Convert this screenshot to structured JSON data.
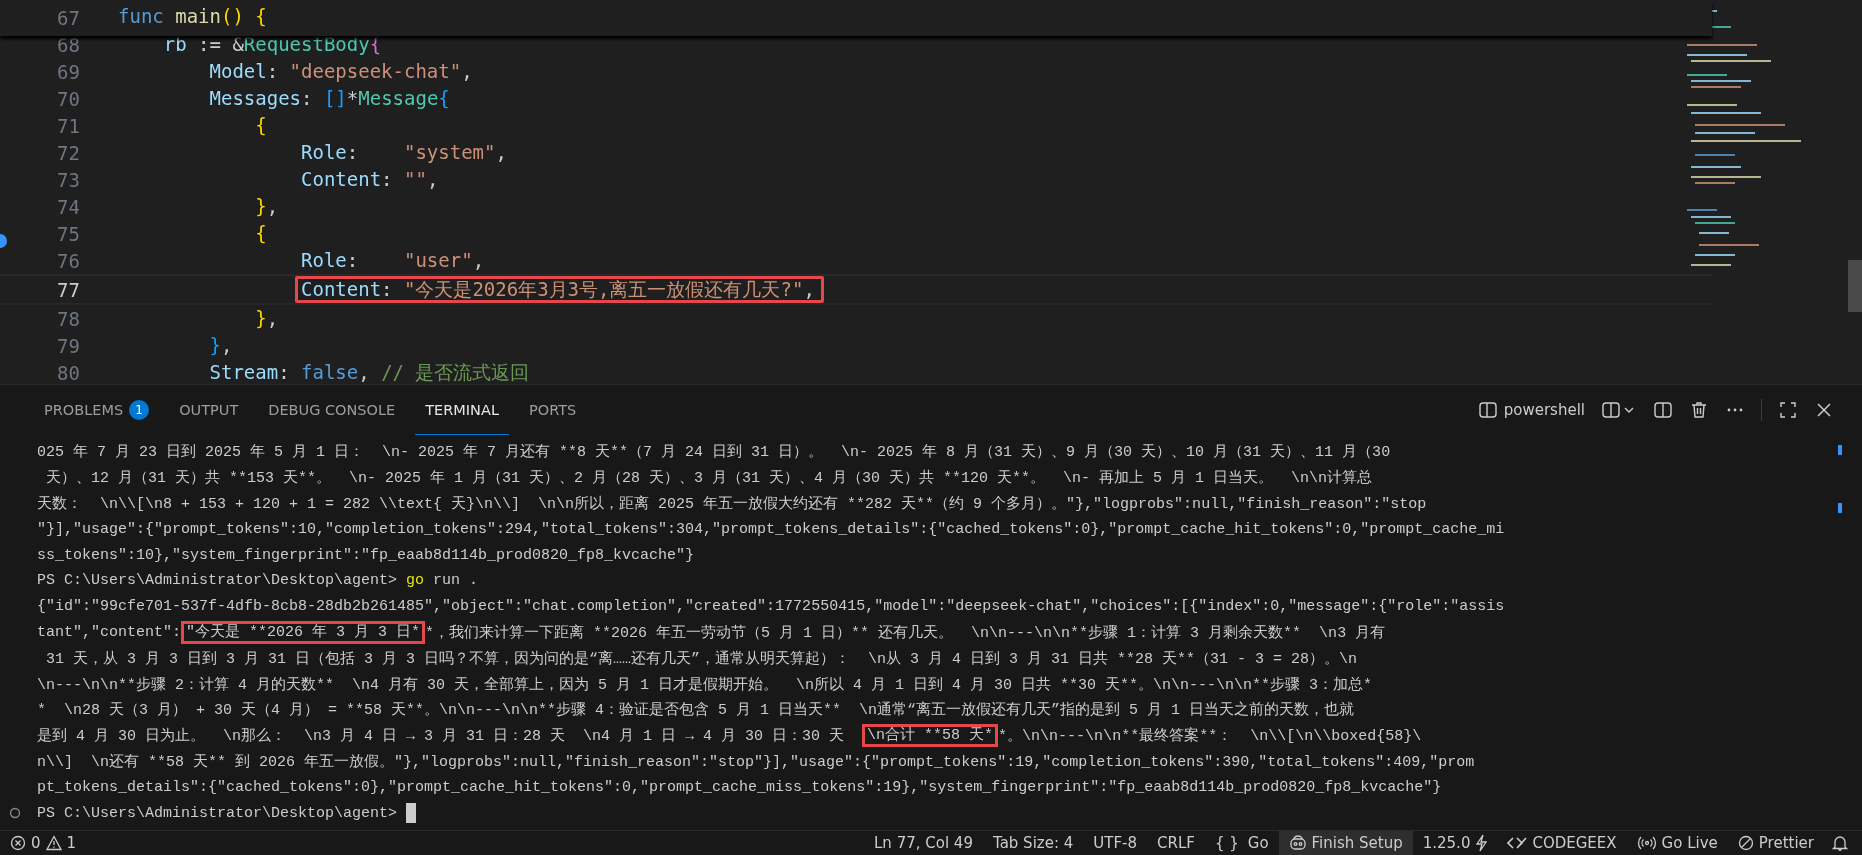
{
  "editor": {
    "code": {
      "number": "67",
      "tokens": [
        {
          "text": "func",
          "kind": "keyword"
        },
        {
          "text": " main",
          "kind": "function"
        },
        {
          "text": "()",
          "kind": "bracket1"
        },
        {
          "text": " {",
          "kind": "bracket1"
        }
      ],
      "children": [
        {
          "number": "68",
          "boxed": false,
          "current": false,
          "tokens": [
            {
              "text": "rb",
              "kind": "field"
            },
            {
              "text": " := &",
              "kind": "plain"
            },
            {
              "text": "RequestBody",
              "kind": "type"
            },
            {
              "text": "{",
              "kind": "bracket2"
            }
          ],
          "children": [
            {
              "number": "69",
              "boxed": false,
              "current": false,
              "tokens": [
                {
                  "text": "Model",
                  "kind": "field"
                },
                {
                  "text": ": ",
                  "kind": "plain"
                },
                {
                  "text": "\"deepseek-chat\"",
                  "kind": "string"
                },
                {
                  "text": ",",
                  "kind": "plain"
                }
              ]
            },
            {
              "number": "70",
              "boxed": false,
              "current": false,
              "tokens": [
                {
                  "text": "Messages",
                  "kind": "field"
                },
                {
                  "text": ": ",
                  "kind": "plain"
                },
                {
                  "text": "[]",
                  "kind": "bracket3"
                },
                {
                  "text": "*",
                  "kind": "plain"
                },
                {
                  "text": "Message",
                  "kind": "type"
                },
                {
                  "text": "{",
                  "kind": "bracket3"
                }
              ],
              "children": [
                {
                  "number": "71",
                  "boxed": false,
                  "current": false,
                  "tokens": [
                    {
                      "text": "{",
                      "kind": "bracket1"
                    }
                  ],
                  "children": [
                    {
                      "number": "72",
                      "boxed": false,
                      "current": false,
                      "tokens": [
                        {
                          "text": "Role",
                          "kind": "field"
                        },
                        {
                          "text": ":    ",
                          "kind": "plain"
                        },
                        {
                          "text": "\"system\"",
                          "kind": "string"
                        },
                        {
                          "text": ",",
                          "kind": "plain"
                        }
                      ]
                    },
                    {
                      "number": "73",
                      "boxed": false,
                      "current": false,
                      "tokens": [
                        {
                          "text": "Content",
                          "kind": "field"
                        },
                        {
                          "text": ": ",
                          "kind": "plain"
                        },
                        {
                          "text": "\"\"",
                          "kind": "string"
                        },
                        {
                          "text": ",",
                          "kind": "plain"
                        }
                      ]
                    }
                  ]
                },
                {
                  "number": "74",
                  "boxed": false,
                  "current": false,
                  "tokens": [
                    {
                      "text": "}",
                      "kind": "bracket1"
                    },
                    {
                      "text": ",",
                      "kind": "plain"
                    }
                  ]
                },
                {
                  "number": "75",
                  "boxed": false,
                  "current": false,
                  "tokens": [
                    {
                      "text": "{",
                      "kind": "bracket1"
                    }
                  ],
                  "children": [
                    {
                      "number": "76",
                      "boxed": false,
                      "current": false,
                      "tokens": [
                        {
                          "text": "Role",
                          "kind": "field"
                        },
                        {
                          "text": ":    ",
                          "kind": "plain"
                        },
                        {
                          "text": "\"user\"",
                          "kind": "string"
                        },
                        {
                          "text": ",",
                          "kind": "plain"
                        }
                      ]
                    },
                    {
                      "number": "77",
                      "boxed": true,
                      "current": true,
                      "tokens": [
                        {
                          "text": "Content",
                          "kind": "field"
                        },
                        {
                          "text": ": ",
                          "kind": "plain"
                        },
                        {
                          "text": "\"今天是2026年3月3号,离五一放假还有几天?\"",
                          "kind": "string"
                        },
                        {
                          "text": ",",
                          "kind": "plain"
                        }
                      ]
                    }
                  ]
                },
                {
                  "number": "78",
                  "boxed": false,
                  "current": false,
                  "tokens": [
                    {
                      "text": "}",
                      "kind": "bracket1"
                    },
                    {
                      "text": ",",
                      "kind": "plain"
                    }
                  ]
                }
              ]
            },
            {
              "number": "79",
              "boxed": false,
              "current": false,
              "tokens": [
                {
                  "text": "}",
                  "kind": "bracket3"
                },
                {
                  "text": ",",
                  "kind": "plain"
                }
              ]
            },
            {
              "number": "80",
              "boxed": false,
              "current": false,
              "tokens": [
                {
                  "text": "Stream",
                  "kind": "field"
                },
                {
                  "text": ": ",
                  "kind": "plain"
                },
                {
                  "text": "false",
                  "kind": "keyword"
                },
                {
                  "text": ", ",
                  "kind": "plain"
                },
                {
                  "text": "// 是否流式返回",
                  "kind": "comment"
                }
              ]
            }
          ]
        }
      ]
    }
  },
  "panel": {
    "tabs": [
      {
        "label": "PROBLEMS",
        "badge": "1",
        "selected": false
      },
      {
        "label": "OUTPUT",
        "selected": false
      },
      {
        "label": "DEBUG CONSOLE",
        "selected": false
      },
      {
        "label": "TERMINAL",
        "selected": true
      },
      {
        "label": "PORTS",
        "selected": false
      }
    ],
    "terminal_name": "powershell",
    "lines": [
      {
        "cursor": false,
        "segments": [
          {
            "text": "025 年 7 月 23 日到 2025 年 5 月 1 日：  \\n- 2025 年 7 月还有 **8 天**（7 月 24 日到 31 日）。  \\n- 2025 年 8 月（31 天）、9 月（30 天）、10 月（31 天）、11 月（30",
            "kind": "plain"
          }
        ]
      },
      {
        "cursor": false,
        "segments": [
          {
            "text": " 天）、12 月（31 天）共 **153 天**。  \\n- 2025 年 1 月（31 天）、2 月（28 天）、3 月（31 天）、4 月（30 天）共 **120 天**。  \\n- 再加上 5 月 1 日当天。  \\n\\n计算总",
            "kind": "plain"
          }
        ]
      },
      {
        "cursor": false,
        "segments": [
          {
            "text": "天数：  \\n\\\\[\\n8 + 153 + 120 + 1 = 282 \\\\text{ 天}\\n\\\\]  \\n\\n所以，距离 2025 年五一放假大约还有 **282 天**（约 9 个多月）。\"},\"logprobs\":null,\"finish_reason\":\"stop",
            "kind": "plain"
          }
        ]
      },
      {
        "cursor": false,
        "segments": [
          {
            "text": "\"}],\"usage\":{\"prompt_tokens\":10,\"completion_tokens\":294,\"total_tokens\":304,\"prompt_tokens_details\":{\"cached_tokens\":0},\"prompt_cache_hit_tokens\":0,\"prompt_cache_mi",
            "kind": "plain"
          }
        ]
      },
      {
        "cursor": false,
        "segments": [
          {
            "text": "ss_tokens\":10},\"system_fingerprint\":\"fp_eaab8d114b_prod0820_fp8_kvcache\"}",
            "kind": "plain"
          }
        ]
      },
      {
        "cursor": false,
        "segments": [
          {
            "text": "PS C:\\Users\\Administrator\\Desktop\\agent> ",
            "kind": "plain"
          },
          {
            "text": "go",
            "kind": "command"
          },
          {
            "text": " run .",
            "kind": "plain"
          }
        ]
      },
      {
        "cursor": false,
        "segments": [
          {
            "text": "{\"id\":\"99cfe701-537f-4dfb-8cb8-28db2b261485\",\"object\":\"chat.completion\",\"created\":1772550415,\"model\":\"deepseek-chat\",\"choices\":[{\"index\":0,\"message\":{\"role\":\"assis",
            "kind": "plain"
          }
        ]
      },
      {
        "cursor": false,
        "segments": [
          {
            "text": "tant\",\"content\":",
            "kind": "plain"
          },
          {
            "text": "\"今天是 **2026 年 3 月 3 日*",
            "kind": "marked"
          },
          {
            "text": "*，我们来计算一下距离 **2026 年五一劳动节（5 月 1 日）** 还有几天。  \\n\\n---\\n\\n**步骤 1：计算 3 月剩余天数**  \\n3 月有",
            "kind": "plain"
          }
        ]
      },
      {
        "cursor": false,
        "segments": [
          {
            "text": " 31 天，从 3 月 3 日到 3 月 31 日（包括 3 月 3 日吗？不算，因为问的是“离……还有几天”，通常从明天算起）：  \\n从 3 月 4 日到 3 月 31 日共 **28 天**（31 - 3 = 28）。\\n",
            "kind": "plain"
          }
        ]
      },
      {
        "cursor": false,
        "segments": [
          {
            "text": "\\n---\\n\\n**步骤 2：计算 4 月的天数**  \\n4 月有 30 天，全部算上，因为 5 月 1 日才是假期开始。  \\n所以 4 月 1 日到 4 月 30 日共 **30 天**。\\n\\n---\\n\\n**步骤 3：加总*",
            "kind": "plain"
          }
        ]
      },
      {
        "cursor": false,
        "segments": [
          {
            "text": "*  \\n28 天（3 月） + 30 天（4 月） = **58 天**。\\n\\n---\\n\\n**步骤 4：验证是否包含 5 月 1 日当天**  \\n通常“离五一放假还有几天”指的是到 5 月 1 日当天之前的天数，也就",
            "kind": "plain"
          }
        ]
      },
      {
        "cursor": false,
        "segments": [
          {
            "text": "是到 4 月 30 日为止。  \\n那么：  \\n3 月 4 日 → 3 月 31 日：28 天  \\n4 月 1 日 → 4 月 30 日：30 天  ",
            "kind": "plain"
          },
          {
            "text": "\\n合计 **58 天*",
            "kind": "marked"
          },
          {
            "text": "*。\\n\\n---\\n\\n**最终答案**：  \\n\\\\[\\n\\\\boxed{58}\\",
            "kind": "plain"
          }
        ]
      },
      {
        "cursor": false,
        "segments": [
          {
            "text": "n\\\\]  \\n还有 **58 天** 到 2026 年五一放假。\"},\"logprobs\":null,\"finish_reason\":\"stop\"}],\"usage\":{\"prompt_tokens\":19,\"completion_tokens\":390,\"total_tokens\":409,\"prom",
            "kind": "plain"
          }
        ]
      },
      {
        "cursor": false,
        "segments": [
          {
            "text": "pt_tokens_details\":{\"cached_tokens\":0},\"prompt_cache_hit_tokens\":0,\"prompt_cache_miss_tokens\":19},\"system_fingerprint\":\"fp_eaab8d114b_prod0820_fp8_kvcache\"}",
            "kind": "plain"
          }
        ]
      },
      {
        "cursor": true,
        "segments": [
          {
            "text": "PS C:\\Users\\Administrator\\Desktop\\agent> ",
            "kind": "plain"
          }
        ]
      }
    ]
  },
  "status_bar": {
    "errors": "0",
    "warnings": "1",
    "position": "Ln 77, Col 49",
    "tab_size": "Tab Size: 4",
    "encoding": "UTF-8",
    "eol": "CRLF",
    "language_braces": "{ }",
    "language": "Go",
    "finish_setup": "Finish Setup",
    "go_version": "1.25.0",
    "codegeex": "CODEGEEX",
    "go_live": "Go Live",
    "prettier": "Prettier"
  }
}
